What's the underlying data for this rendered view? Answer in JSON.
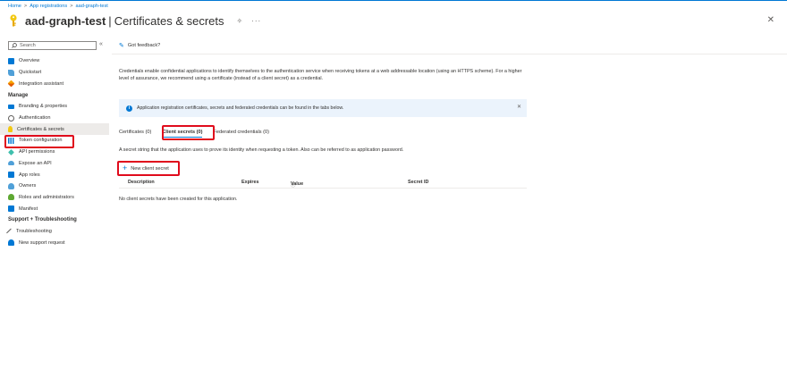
{
  "breadcrumb": {
    "items": [
      "Home",
      "App registrations",
      "aad-graph-test"
    ],
    "separator": ">"
  },
  "header": {
    "app_name": "aad-graph-test",
    "pipe": "|",
    "page_name": "Certificates & secrets",
    "pin_glyph": "✧",
    "more_glyph": "···",
    "close_glyph": "✕"
  },
  "sidebar": {
    "search_placeholder": "Search",
    "collapse_glyph": "«",
    "top_items": [
      {
        "label": "Overview",
        "icon": "overview-icon"
      },
      {
        "label": "Quickstart",
        "icon": "quickstart-icon"
      },
      {
        "label": "Integration assistant",
        "icon": "rocket-icon"
      }
    ],
    "manage_heading": "Manage",
    "manage_items": [
      {
        "label": "Branding & properties",
        "icon": "branding-icon"
      },
      {
        "label": "Authentication",
        "icon": "authentication-icon"
      },
      {
        "label": "Certificates & secrets",
        "icon": "key-icon"
      },
      {
        "label": "Token configuration",
        "icon": "token-icon"
      },
      {
        "label": "API permissions",
        "icon": "api-permissions-icon"
      },
      {
        "label": "Expose an API",
        "icon": "cloud-icon"
      },
      {
        "label": "App roles",
        "icon": "app-roles-icon"
      },
      {
        "label": "Owners",
        "icon": "owners-icon"
      },
      {
        "label": "Roles and administrators",
        "icon": "roles-icon"
      },
      {
        "label": "Manifest",
        "icon": "manifest-icon"
      }
    ],
    "support_heading": "Support + Troubleshooting",
    "support_items": [
      {
        "label": "Troubleshooting",
        "icon": "wrench-icon"
      },
      {
        "label": "New support request",
        "icon": "support-request-icon"
      }
    ]
  },
  "main": {
    "feedback_label": "Got feedback?",
    "description": "Credentials enable confidential applications to identify themselves to the authentication service when receiving tokens at a web addressable location (using an HTTPS scheme). For a higher level of assurance, we recommend using a certificate (instead of a client secret) as a credential.",
    "info_banner": "Application registration certificates, secrets and federated credentials can be found in the tabs below.",
    "info_close": "✕",
    "tabs": [
      "Certificates (0)",
      "Client secrets (0)",
      "Federated credentials (0)"
    ],
    "active_tab": "Client secrets (0)",
    "secret_description": "A secret string that the application uses to prove its identity when requesting a token. Also can be referred to as application password.",
    "new_secret_label": "New client secret",
    "table": {
      "columns": [
        "Description",
        "Expires",
        "Value",
        "Secret ID"
      ],
      "value_info_glyph": "ⓘ",
      "empty_message": "No client secrets have been created for this application."
    }
  },
  "colors": {
    "accent": "#0078d4",
    "highlight_red": "#e00b1c",
    "info_background": "#ebf3fc"
  }
}
